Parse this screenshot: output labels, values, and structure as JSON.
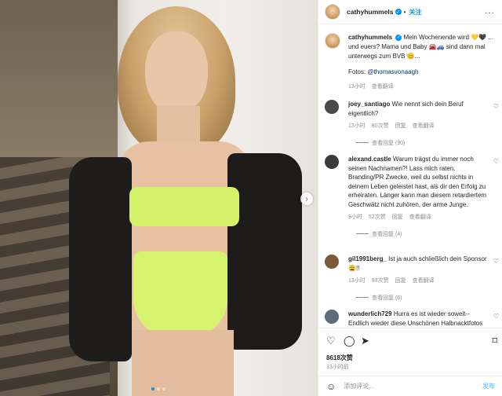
{
  "header": {
    "username": "cathyhummels",
    "follow_label": "关注",
    "more_label": "···"
  },
  "caption": {
    "username": "cathyhummels",
    "text": "Mein Wochenende wird 💛🖤 ... und euers? Mama und Baby 🚘🚙 sind dann mal unterwegs zum BVB 😊...",
    "photo_credit_prefix": "Fotos: ",
    "photo_credit_handle": "@thomasvonaagh",
    "time": "13小时",
    "translate": "查看翻译"
  },
  "comments": [
    {
      "username": "joey_santiago",
      "text": "Wie nennt sich dein Beruf eigentlich?",
      "time": "13小时",
      "likes": "80次赞",
      "reply": "回复",
      "translate": "查看翻译",
      "replies": "查看回复 (30)",
      "avatar_color": "#4a4a4a"
    },
    {
      "username": "alexand.castle",
      "text": "Warum trägst du immer noch seinen Nachnamen?! Lass mich raten. Branding/PR Zwecke, weil du selbst nichts in deinem Leben geleistet hast, als dir den Erfolg zu erheiraten. Länger kann man diesem retardiertem Geschwätz nicht zuhören, der arme Junge.",
      "time": "9小时",
      "likes": "52次赞",
      "reply": "回复",
      "translate": "查看翻译",
      "replies": "查看回复 (4)",
      "avatar_color": "#3b3b3b"
    },
    {
      "username": "gil1991berg_",
      "text": "Ist ja auch schließlich dein Sponsor 😩!!",
      "time": "13小时",
      "likes": "93次赞",
      "reply": "回复",
      "translate": "查看翻译",
      "replies": "查看回复 (6)",
      "avatar_color": "#7a5a3a"
    },
    {
      "username": "wunderlich729",
      "text": "Hurra es ist wieder soweit-- Endlich wieder diese Unschönen Halbnacktfotos",
      "avatar_color": "#5d6b7a"
    }
  ],
  "actions": {
    "likes": "8618次赞",
    "time": "13小时前"
  },
  "add_comment": {
    "placeholder": "添加评论...",
    "post_label": "发布"
  },
  "colors": {
    "accent": "#0095f6",
    "muted": "#8e8e8e",
    "text": "#262626"
  },
  "icons": {
    "heart": "heart-icon",
    "comment": "comment-icon",
    "share": "paper-plane-icon",
    "save": "bookmark-icon",
    "emoji": "smiley-icon",
    "next": "chevron-right-icon",
    "verified": "verified-badge-icon"
  }
}
